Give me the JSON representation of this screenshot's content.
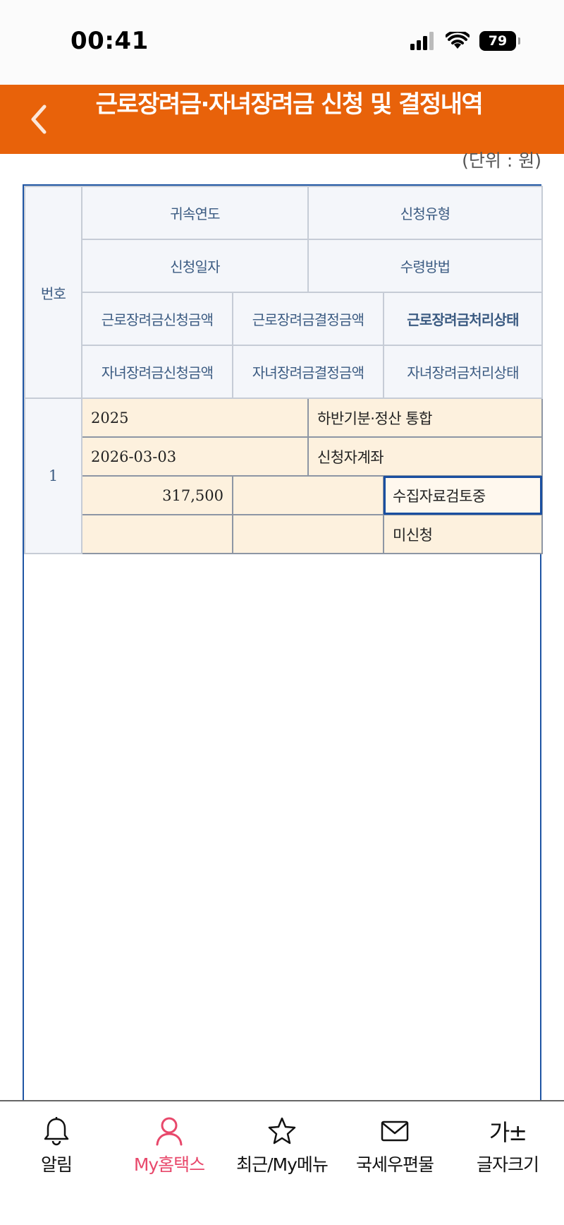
{
  "status": {
    "time": "00:41",
    "battery": "79"
  },
  "header": {
    "title": "근로장려금·자녀장려금 신청 및 결정내역",
    "back_icon": "chevron-left-icon"
  },
  "unit_note": "(단위 : 원)",
  "table": {
    "headers": {
      "number": "번호",
      "year": "귀속연도",
      "apply_type": "신청유형",
      "apply_date": "신청일자",
      "receive_method": "수령방법",
      "work_apply_amount": "근로장려금신청금액",
      "work_decision_amount": "근로장려금결정금액",
      "work_status": "근로장려금처리상태",
      "child_apply_amount": "자녀장려금신청금액",
      "child_decision_amount": "자녀장려금결정금액",
      "child_status": "자녀장려금처리상태"
    },
    "rows": [
      {
        "number": "1",
        "year": "2025",
        "apply_type": "하반기분·정산 통합",
        "apply_date": "2026-03-03",
        "receive_method": "신청자계좌",
        "work_apply_amount": "317,500",
        "work_decision_amount": "",
        "work_status": "수집자료검토중",
        "child_apply_amount": "",
        "child_decision_amount": "",
        "child_status": "미신청"
      }
    ]
  },
  "bottom_nav": [
    {
      "label": "알림",
      "icon": "bell-icon",
      "active": false
    },
    {
      "label": "My홈택스",
      "icon": "person-icon",
      "active": true
    },
    {
      "label": "최근/My메뉴",
      "icon": "star-icon",
      "active": false
    },
    {
      "label": "국세우편물",
      "icon": "mail-icon",
      "active": false
    },
    {
      "label": "글자크기",
      "icon": "font-size-icon",
      "active": false
    }
  ],
  "colors": {
    "header": "#e8620a",
    "table_border": "#1f55a3",
    "data_bg": "#fdf1de",
    "active_nav": "#e8486b"
  }
}
